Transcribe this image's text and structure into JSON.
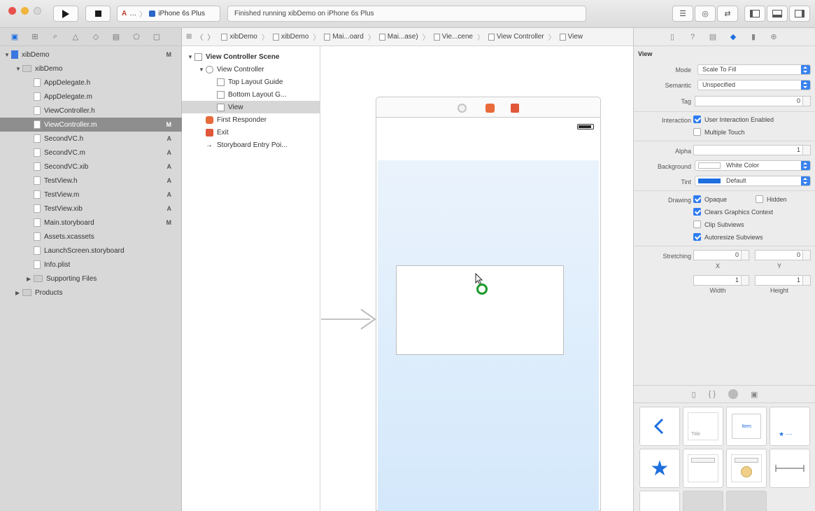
{
  "toolbar": {
    "scheme_project": "…",
    "scheme_device": "iPhone 6s Plus",
    "status_text": "Finished running xibDemo on iPhone 6s Plus"
  },
  "navigator": {
    "rows": [
      {
        "name": "xibDemo",
        "level": 0,
        "kind": "project",
        "badge": "M",
        "disclosure": "▼"
      },
      {
        "name": "xibDemo",
        "level": 1,
        "kind": "folder",
        "badge": "",
        "disclosure": "▼"
      },
      {
        "name": "AppDelegate.h",
        "level": 2,
        "kind": "file",
        "badge": "",
        "disclosure": ""
      },
      {
        "name": "AppDelegate.m",
        "level": 2,
        "kind": "file",
        "badge": "",
        "disclosure": ""
      },
      {
        "name": "ViewController.h",
        "level": 2,
        "kind": "file",
        "badge": "",
        "disclosure": ""
      },
      {
        "name": "ViewController.m",
        "level": 2,
        "kind": "file",
        "badge": "M",
        "disclosure": "",
        "selected": true
      },
      {
        "name": "SecondVC.h",
        "level": 2,
        "kind": "file",
        "badge": "A",
        "disclosure": ""
      },
      {
        "name": "SecondVC.m",
        "level": 2,
        "kind": "file",
        "badge": "A",
        "disclosure": ""
      },
      {
        "name": "SecondVC.xib",
        "level": 2,
        "kind": "file",
        "badge": "A",
        "disclosure": ""
      },
      {
        "name": "TestView.h",
        "level": 2,
        "kind": "file",
        "badge": "A",
        "disclosure": ""
      },
      {
        "name": "TestView.m",
        "level": 2,
        "kind": "file",
        "badge": "A",
        "disclosure": ""
      },
      {
        "name": "TestView.xib",
        "level": 2,
        "kind": "file",
        "badge": "A",
        "disclosure": ""
      },
      {
        "name": "Main.storyboard",
        "level": 2,
        "kind": "file",
        "badge": "M",
        "disclosure": ""
      },
      {
        "name": "Assets.xcassets",
        "level": 2,
        "kind": "file",
        "badge": "",
        "disclosure": ""
      },
      {
        "name": "LaunchScreen.storyboard",
        "level": 2,
        "kind": "file",
        "badge": "",
        "disclosure": ""
      },
      {
        "name": "Info.plist",
        "level": 2,
        "kind": "file",
        "badge": "",
        "disclosure": ""
      },
      {
        "name": "Supporting Files",
        "level": 2,
        "kind": "folder",
        "badge": "",
        "disclosure": "▶"
      },
      {
        "name": "Products",
        "level": 1,
        "kind": "folder",
        "badge": "",
        "disclosure": "▶"
      }
    ]
  },
  "jumpbar": {
    "crumbs": [
      "xibDemo",
      "xibDemo",
      "Mai...oard",
      "Mai...ase)",
      "Vie...cene",
      "View Controller",
      "View"
    ]
  },
  "outline": {
    "rows": [
      {
        "name": "View Controller Scene",
        "level": 0,
        "icon": "scene",
        "bold": true,
        "disclosure": "▼"
      },
      {
        "name": "View Controller",
        "level": 1,
        "icon": "vc",
        "bold": false,
        "disclosure": "▼"
      },
      {
        "name": "Top Layout Guide",
        "level": 2,
        "icon": "box",
        "bold": false,
        "disclosure": ""
      },
      {
        "name": "Bottom Layout G...",
        "level": 2,
        "icon": "box",
        "bold": false,
        "disclosure": ""
      },
      {
        "name": "View",
        "level": 2,
        "icon": "box",
        "bold": false,
        "disclosure": "",
        "selected": true
      },
      {
        "name": "First Responder",
        "level": 1,
        "icon": "responder",
        "bold": false,
        "disclosure": ""
      },
      {
        "name": "Exit",
        "level": 1,
        "icon": "exit",
        "bold": false,
        "disclosure": ""
      },
      {
        "name": "Storyboard Entry Poi...",
        "level": 1,
        "icon": "arrow",
        "bold": false,
        "disclosure": ""
      }
    ]
  },
  "inspector": {
    "section_title": "View",
    "mode_label": "Mode",
    "mode_value": "Scale To Fill",
    "semantic_label": "Semantic",
    "semantic_value": "Unspecified",
    "tag_label": "Tag",
    "tag_value": "0",
    "interaction_label": "Interaction",
    "user_interaction_label": "User Interaction Enabled",
    "user_interaction": true,
    "multiple_touch_label": "Multiple Touch",
    "multiple_touch": false,
    "alpha_label": "Alpha",
    "alpha_value": "1",
    "background_label": "Background",
    "background_value": "White Color",
    "tint_label": "Tint",
    "tint_value": "Default",
    "tint_color": "#1e6fe0",
    "drawing_label": "Drawing",
    "opaque_label": "Opaque",
    "opaque": true,
    "hidden_label": "Hidden",
    "hidden": false,
    "clears_label": "Clears Graphics Context",
    "clears": true,
    "clip_label": "Clip Subviews",
    "clip": false,
    "autoresize_label": "Autoresize Subviews",
    "autoresize": true,
    "stretching_label": "Stretching",
    "stretch_x_value": "0",
    "stretch_y_value": "0",
    "stretch_w_value": "1",
    "stretch_h_value": "1",
    "x_label": "X",
    "y_label": "Y",
    "width_label": "Width",
    "height_label": "Height"
  },
  "library": {
    "item_labels": [
      "Title",
      "Item"
    ]
  },
  "colors": {
    "accent": "#1e6fe0",
    "selection_gray": "#8e8e8e",
    "canvas_blue": "#d4e8fb"
  }
}
